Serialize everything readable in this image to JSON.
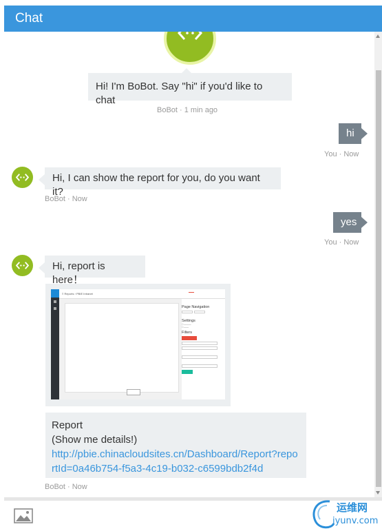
{
  "header": {
    "title": "Chat"
  },
  "messages": {
    "welcome": {
      "text": "Hi! I'm BoBot. Say \"hi\" if you'd like to chat",
      "timestamp": "BoBot · 1 min ago"
    },
    "user1": {
      "text": "hi",
      "timestamp": "You · Now"
    },
    "bot1": {
      "text": "Hi, I can show the report for you, do you want it?",
      "timestamp": "BoBot · Now"
    },
    "user2": {
      "text": "yes",
      "timestamp": "You · Now"
    },
    "bot2": {
      "text": "Hi, report is here！"
    },
    "report_preview": {
      "top_bar": "≡   Reports  ›  PBIE Intranet",
      "panel_nav": "Page Navigation",
      "panel_settings": "Settings",
      "panel_filters": "Filters"
    },
    "card": {
      "title": "Report",
      "subtitle": "(Show me details!)",
      "link": "http://pbie.chinacloudsites.cn/Dashboard/Report?reportId=0a46b754-f5a3-4c19-b032-c6599bdb2f4d",
      "timestamp": "BoBot · Now"
    }
  },
  "input": {
    "upload_icon": "image-icon"
  },
  "watermark": {
    "cn": "运维网",
    "en": "iyunv.com"
  },
  "colors": {
    "accent": "#3a96dd",
    "bot_green": "#92bc22",
    "user_bubble": "#76828c",
    "bot_bubble": "#eceff1"
  }
}
